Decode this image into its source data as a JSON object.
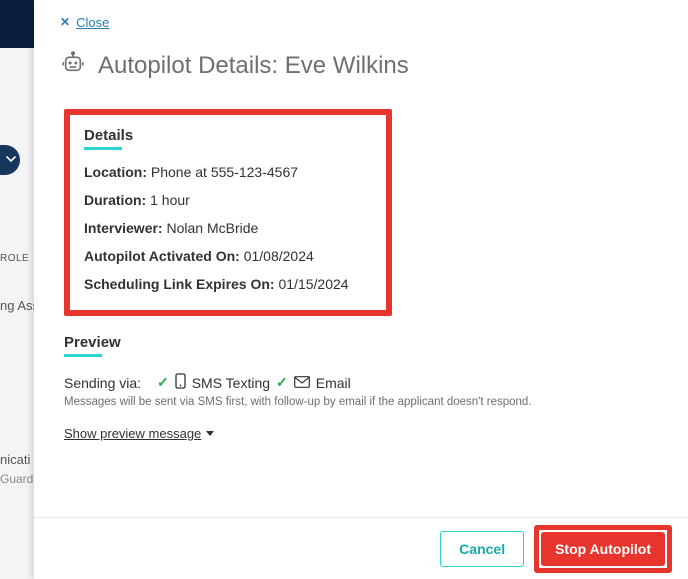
{
  "close": {
    "label": "Close"
  },
  "title": "Autopilot Details: Eve Wilkins",
  "background_fragments": {
    "role": "ROLE",
    "row1": "ng Ass",
    "row2a": "nicati",
    "row2b": "Guard"
  },
  "details": {
    "heading": "Details",
    "location_label": "Location:",
    "location_value": "Phone at 555-123-4567",
    "duration_label": "Duration:",
    "duration_value": "1 hour",
    "interviewer_label": "Interviewer:",
    "interviewer_value": "Nolan McBride",
    "activated_label": "Autopilot Activated On:",
    "activated_value": "01/08/2024",
    "expires_label": "Scheduling Link Expires On:",
    "expires_value": "01/15/2024"
  },
  "preview": {
    "heading": "Preview",
    "sending_prefix": "Sending via:",
    "sms_label": "SMS Texting",
    "email_label": "Email",
    "note": "Messages will be sent via SMS first, with follow-up by email if the applicant doesn't respond.",
    "show_link": "Show preview message"
  },
  "footer": {
    "cancel": "Cancel",
    "stop": "Stop Autopilot"
  }
}
